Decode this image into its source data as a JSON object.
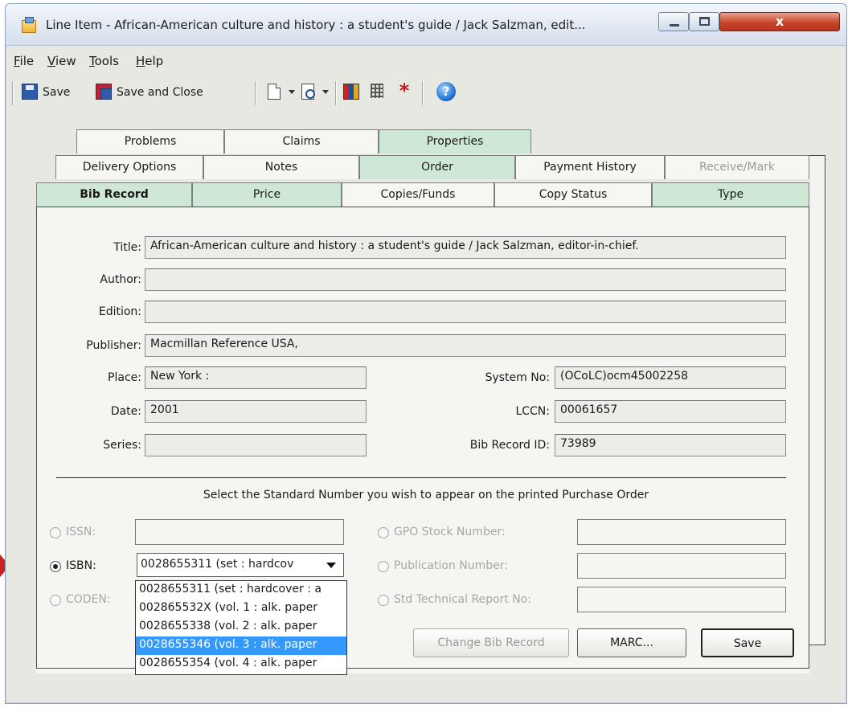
{
  "window": {
    "title": "Line Item - African-American culture and history : a student's guide / Jack Salzman, edit...",
    "close_glyph": "x"
  },
  "menu": [
    "File",
    "View",
    "Tools",
    "Help"
  ],
  "toolbar": {
    "save_label": "Save",
    "save_close_label": "Save and Close",
    "help_glyph": "?",
    "asterisk_glyph": "*"
  },
  "tabs": {
    "row1": [
      "Problems",
      "Claims",
      "Properties"
    ],
    "row2": [
      "Delivery Options",
      "Notes",
      "Order",
      "Payment History",
      "Receive/Mark"
    ],
    "row3": [
      "Bib Record",
      "Price",
      "Copies/Funds",
      "Copy Status",
      "Type"
    ]
  },
  "bib": {
    "title_label": "Title:",
    "title_value": "African-American culture and history : a student's guide / Jack Salzman, editor-in-chief.",
    "author_label": "Author:",
    "author_value": "",
    "edition_label": "Edition:",
    "edition_value": "",
    "publisher_label": "Publisher:",
    "publisher_value": "Macmillan Reference USA,",
    "place_label": "Place:",
    "place_value": "New York :",
    "date_label": "Date:",
    "date_value": "2001",
    "series_label": "Series:",
    "series_value": "",
    "system_no_label": "System No:",
    "system_no_value": "(OCoLC)ocm45002258",
    "lccn_label": "LCCN:",
    "lccn_value": "00061657",
    "bib_id_label": "Bib Record ID:",
    "bib_id_value": "73989"
  },
  "standard_number": {
    "instruction": "Select the Standard Number you wish to appear on the printed Purchase Order",
    "issn_label": "ISSN:",
    "isbn_label": "ISBN:",
    "coden_label": "CODEN:",
    "gpo_label": "GPO Stock Number:",
    "pub_no_label": "Publication Number:",
    "std_tech_label": "Std Technical Report No:",
    "isbn_selected": "0028655311 (set : hardcov",
    "isbn_options": [
      "0028655311 (set : hardcover : a",
      "002865532X (vol. 1 : alk. paper",
      "0028655338 (vol. 2 : alk. paper",
      "0028655346 (vol. 3 : alk. paper",
      "0028655354 (vol. 4 : alk. paper"
    ],
    "selected_index": 3
  },
  "buttons": {
    "change_bib": "Change Bib Record",
    "marc": "MARC...",
    "save": "Save"
  }
}
